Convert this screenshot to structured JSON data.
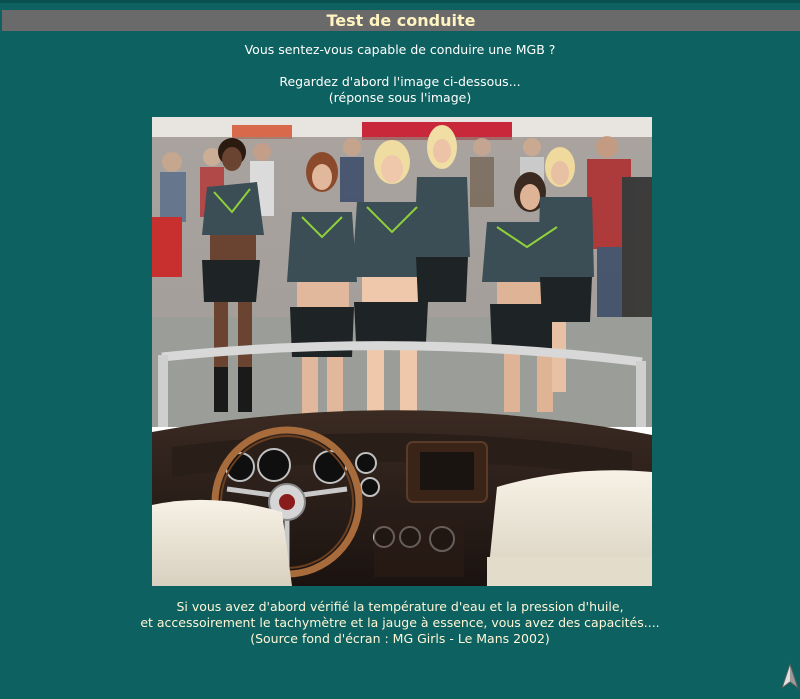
{
  "page": {
    "title": "Test de conduite",
    "intro_line1": "Vous sentez-vous capable de conduire une MGB ?",
    "intro_line2": "Regardez d'abord l'image ci-dessous...",
    "intro_line3": "(réponse sous l'image)",
    "caption_line1": "Si vous avez d'abord vérifié la température d'eau et la pression d'huile,",
    "caption_line2": "et accessoirement le tachymètre et la jauge à essence, vous avez des capacités....",
    "caption_line3": "(Source fond d'écran : MG Girls - Le Mans 2002)"
  },
  "colors": {
    "background": "#0d6161",
    "title_bar": "#6a6a6a",
    "title_text": "#fff3c0",
    "caption_text": "#fff6d6"
  },
  "icons": {
    "nav": "up-arrow-icon"
  }
}
